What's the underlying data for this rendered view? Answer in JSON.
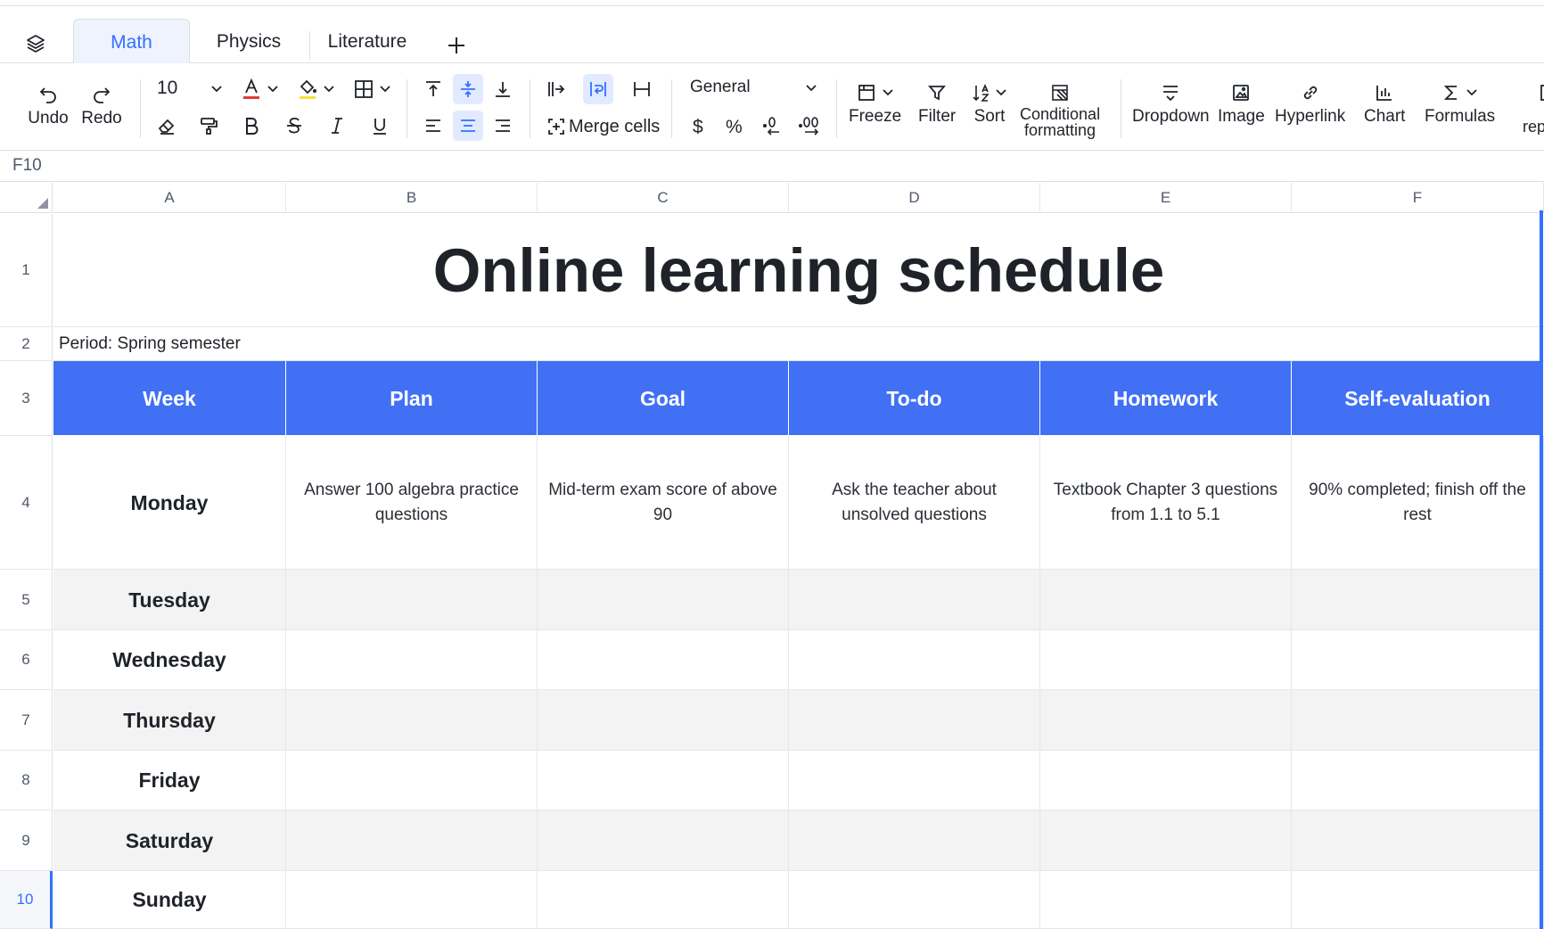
{
  "tabs": {
    "layers_icon": "layers-icon",
    "items": [
      "Math",
      "Physics",
      "Literature"
    ],
    "add_icon": "plus-icon"
  },
  "toolbar": {
    "undo": "Undo",
    "redo": "Redo",
    "font_size": "10",
    "merge_cells": "Merge cells",
    "number_format": "General",
    "currency": "$",
    "percent": "%",
    "freeze": "Freeze",
    "filter": "Filter",
    "sort": "Sort",
    "conditional_line1": "Conditional",
    "conditional_line2": "formatting",
    "dropdown": "Dropdown",
    "image": "Image",
    "hyperlink": "Hyperlink",
    "chart": "Chart",
    "formulas": "Formulas",
    "more_partial": "rep",
    "accent_color": "#3370ff",
    "font_color_bar": "#e23c3c",
    "fill_color_bar": "#f7e03a"
  },
  "formula_bar": {
    "cell_ref": "F10"
  },
  "columns": [
    "A",
    "B",
    "C",
    "D",
    "E",
    "F"
  ],
  "rows": [
    "1",
    "2",
    "3",
    "4",
    "5",
    "6",
    "7",
    "8",
    "9",
    "10"
  ],
  "sheet": {
    "title": "Online learning schedule",
    "period": "Period: Spring semester",
    "header_color": "#4170f5",
    "headers": [
      "Week",
      "Plan",
      "Goal",
      "To-do",
      "Homework",
      "Self-evaluation"
    ],
    "monday": {
      "day": "Monday",
      "plan": "Answer 100 algebra practice questions",
      "goal": "Mid-term exam score of above 90",
      "todo": "Ask the teacher about unsolved questions",
      "homework": "Textbook Chapter 3 questions from 1.1 to 5.1",
      "self_eval": "90% completed; finish off the rest"
    },
    "days": [
      "Tuesday",
      "Wednesday",
      "Thursday",
      "Friday",
      "Saturday",
      "Sunday"
    ]
  }
}
